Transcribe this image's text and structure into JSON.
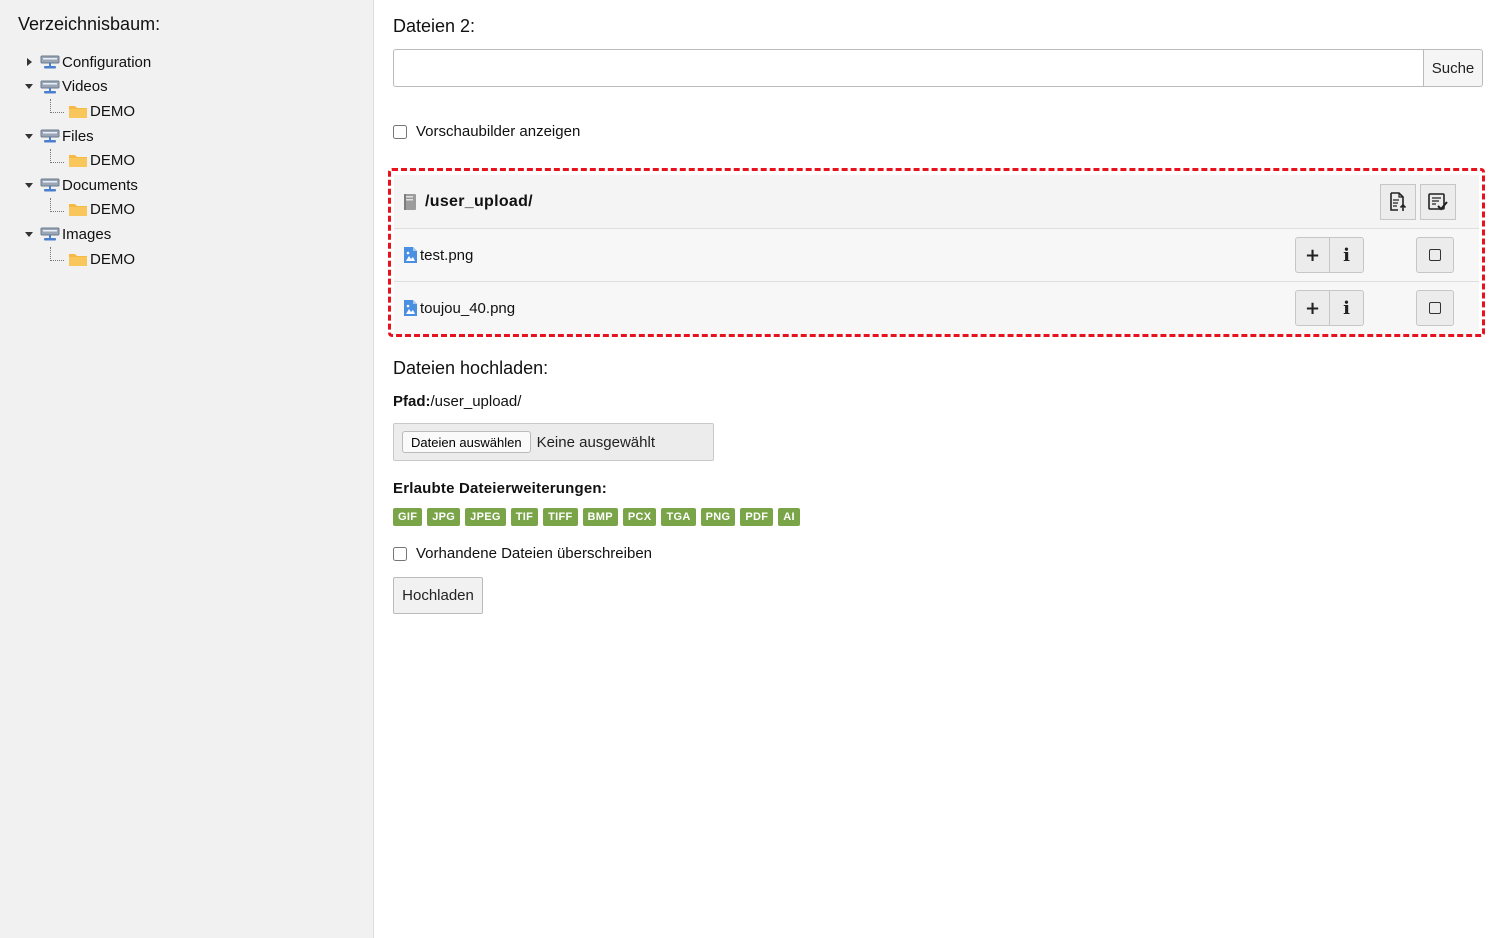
{
  "sidebar": {
    "title": "Verzeichnisbaum:",
    "tree": [
      {
        "label": "Configuration",
        "expanded": false,
        "children": []
      },
      {
        "label": "Videos",
        "expanded": true,
        "children": [
          "DEMO"
        ]
      },
      {
        "label": "Files",
        "expanded": true,
        "children": [
          "DEMO"
        ]
      },
      {
        "label": "Documents",
        "expanded": true,
        "children": [
          "DEMO"
        ]
      },
      {
        "label": "Images",
        "expanded": true,
        "children": [
          "DEMO"
        ]
      }
    ]
  },
  "main": {
    "files_title": "Dateien 2:",
    "search": {
      "value": "",
      "placeholder": "",
      "button": "Suche"
    },
    "preview_checkbox": {
      "label": "Vorschaubilder anzeigen",
      "checked": false
    },
    "directory": {
      "path": "/user_upload/"
    },
    "files": [
      {
        "name": "test.png",
        "add_label": "+",
        "info_label": "i"
      },
      {
        "name": "toujou_40.png",
        "add_label": "+",
        "info_label": "i"
      }
    ],
    "upload": {
      "title": "Dateien hochladen:",
      "path_label": "Pfad:",
      "path_value": "/user_upload/",
      "choose_button": "Dateien auswählen",
      "choose_status": "Keine ausgewählt",
      "extensions_title": "Erlaubte Dateierweiterungen:",
      "extensions": [
        "GIF",
        "JPG",
        "JPEG",
        "TIF",
        "TIFF",
        "BMP",
        "PCX",
        "TGA",
        "PNG",
        "PDF",
        "AI"
      ],
      "overwrite_checkbox": {
        "label": "Vorhandene Dateien überschreiben",
        "checked": false
      },
      "submit": "Hochladen"
    }
  },
  "colors": {
    "sidebar_bg": "#f1f1f1",
    "highlight_border": "#e8121e",
    "extension_badge": "#79a548",
    "folder": "#f5b944",
    "storage": "#8a9bb0",
    "file_icon": "#4a8fe0"
  },
  "icons": {
    "storage": "storage-drive-icon",
    "folder": "folder-icon",
    "directory": "directory-icon",
    "image_file": "image-file-icon",
    "upload": "upload-file-icon",
    "select_all": "select-all-icon",
    "checkbox": "checkbox-icon"
  }
}
